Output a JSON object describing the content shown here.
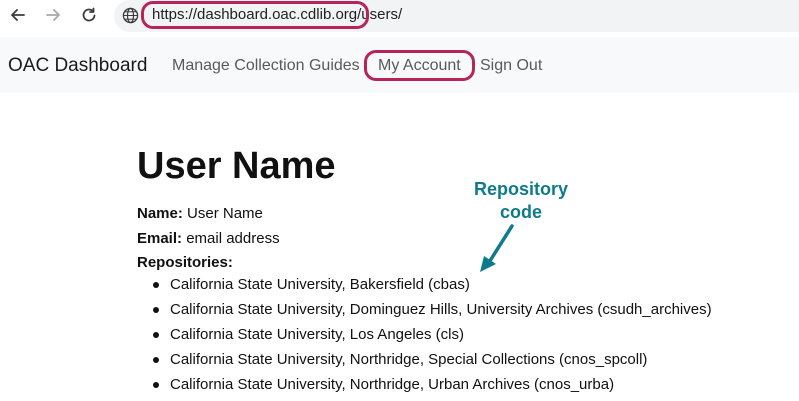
{
  "browser": {
    "url": "https://dashboard.oac.cdlib.org/users/",
    "icons": {
      "back": "arrow-left-icon",
      "forward": "arrow-right-icon",
      "reload": "reload-icon",
      "site": "globe-icon"
    }
  },
  "navbar": {
    "brand": "OAC Dashboard",
    "links": [
      "Manage Collection Guides",
      "My Account",
      "Sign Out"
    ]
  },
  "user": {
    "title": "User Name",
    "name_label": "Name:",
    "name_value": "User Name",
    "email_label": "Email:",
    "email_value": "email address",
    "repos_label": "Repositories:",
    "repositories": [
      "California State University, Bakersfield (cbas)",
      "California State University, Dominguez Hills, University Archives (csudh_archives)",
      "California State University, Los Angeles (cls)",
      "California State University, Northridge, Special Collections (cnos_spcoll)",
      "California State University, Northridge, Urban Archives (cnos_urba)"
    ]
  },
  "annotation": {
    "line1": "Repository",
    "line2": "code",
    "color": "#0e7a8c"
  },
  "highlight_color": "#b5245a"
}
